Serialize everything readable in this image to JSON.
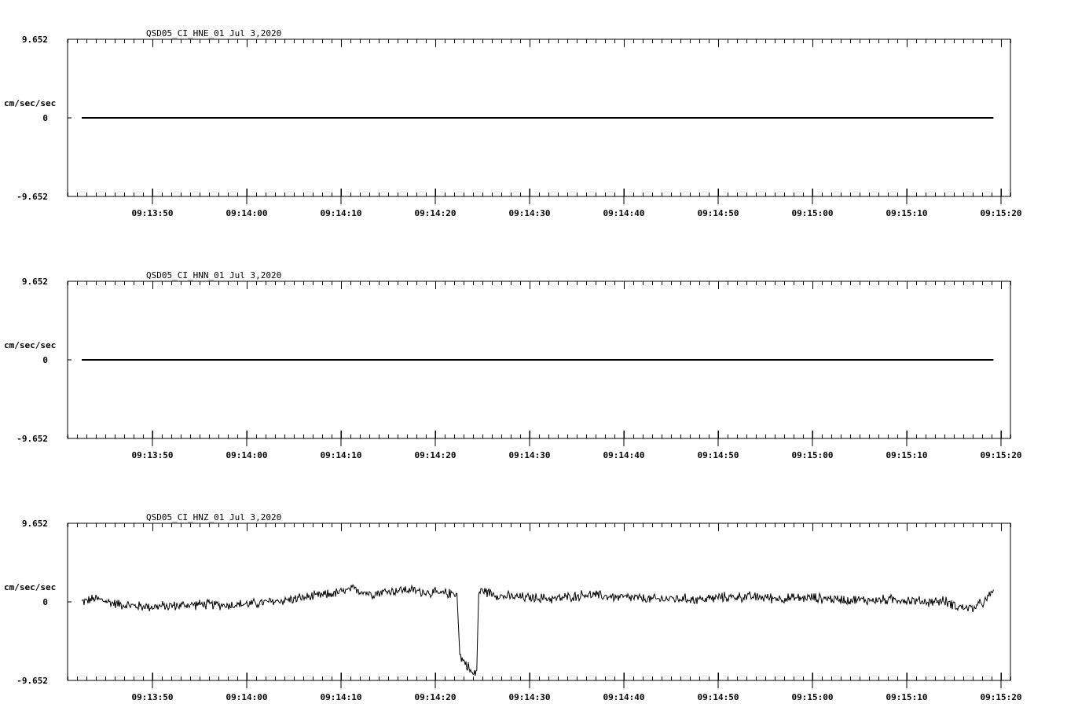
{
  "chart_data": [
    {
      "type": "line",
      "title": "QSD05_CI_HNE_01  Jul 3,2020",
      "ylabel": "cm/sec/sec",
      "yticks": [
        "9.652",
        "0",
        "-9.652"
      ],
      "ylim": [
        -9.652,
        9.652
      ],
      "xlim_seconds_after_09_13": [
        41.0,
        141.0
      ],
      "xticks": [
        "09:13:50",
        "09:14:00",
        "09:14:10",
        "09:14:20",
        "09:14:30",
        "09:14:40",
        "09:14:50",
        "09:15:00",
        "09:15:10",
        "09:15:20"
      ],
      "grid": false,
      "series": [
        {
          "x_start": "09:13:42.5",
          "x_end": "09:15:19.2",
          "trace": "flat",
          "values_first_last": [
            0.0,
            0.0
          ]
        }
      ]
    },
    {
      "type": "line",
      "title": "QSD05_CI_HNN_01  Jul 3,2020",
      "ylabel": "cm/sec/sec",
      "yticks": [
        "9.652",
        "0",
        "-9.652"
      ],
      "ylim": [
        -9.652,
        9.652
      ],
      "xlim_seconds_after_09_13": [
        41.0,
        141.0
      ],
      "xticks": [
        "09:13:50",
        "09:14:00",
        "09:14:10",
        "09:14:20",
        "09:14:30",
        "09:14:40",
        "09:14:50",
        "09:15:00",
        "09:15:10",
        "09:15:20"
      ],
      "grid": false,
      "series": [
        {
          "x_start": "09:13:42.5",
          "x_end": "09:15:19.2",
          "trace": "flat",
          "values_first_last": [
            0.0,
            0.0
          ]
        }
      ]
    },
    {
      "type": "line",
      "title": "QSD05_CI_HNZ_01  Jul 3,2020",
      "ylabel": "cm/sec/sec",
      "yticks": [
        "9.652",
        "0",
        "-9.652"
      ],
      "ylim": [
        -9.652,
        9.652
      ],
      "xlim_seconds_after_09_13": [
        41.0,
        141.0
      ],
      "xticks": [
        "09:13:50",
        "09:14:00",
        "09:14:10",
        "09:14:20",
        "09:14:30",
        "09:14:40",
        "09:14:50",
        "09:15:00",
        "09:15:10",
        "09:15:20"
      ],
      "grid": false,
      "series": [
        {
          "trace": "noisy",
          "x": [
            42.5,
            44,
            46,
            48,
            50,
            52,
            55,
            58,
            61,
            64,
            66,
            68,
            70,
            71.5,
            73,
            75,
            77,
            79,
            80.5,
            82,
            82.3,
            82.6,
            83.5,
            84,
            84.4,
            84.6,
            85,
            87,
            90,
            93,
            96,
            99,
            101,
            103,
            105,
            108,
            111,
            114,
            117,
            120,
            123,
            126,
            129,
            132,
            134,
            135.5,
            137,
            138.5,
            139.2
          ],
          "y": [
            0.0,
            0.4,
            -0.2,
            -0.5,
            -0.6,
            -0.5,
            -0.3,
            -0.4,
            -0.2,
            0.2,
            0.5,
            0.8,
            1.2,
            1.6,
            1.0,
            1.3,
            1.5,
            1.2,
            1.0,
            1.1,
            1.0,
            -6.6,
            -8.0,
            -9.0,
            -8.4,
            1.1,
            1.4,
            0.7,
            0.5,
            0.4,
            0.9,
            0.6,
            0.5,
            0.3,
            0.4,
            0.3,
            0.6,
            0.6,
            0.4,
            0.5,
            0.3,
            0.2,
            0.3,
            0.0,
            0.1,
            -0.6,
            -0.8,
            0.2,
            1.5
          ],
          "noise_amplitude": 0.5
        }
      ]
    }
  ]
}
